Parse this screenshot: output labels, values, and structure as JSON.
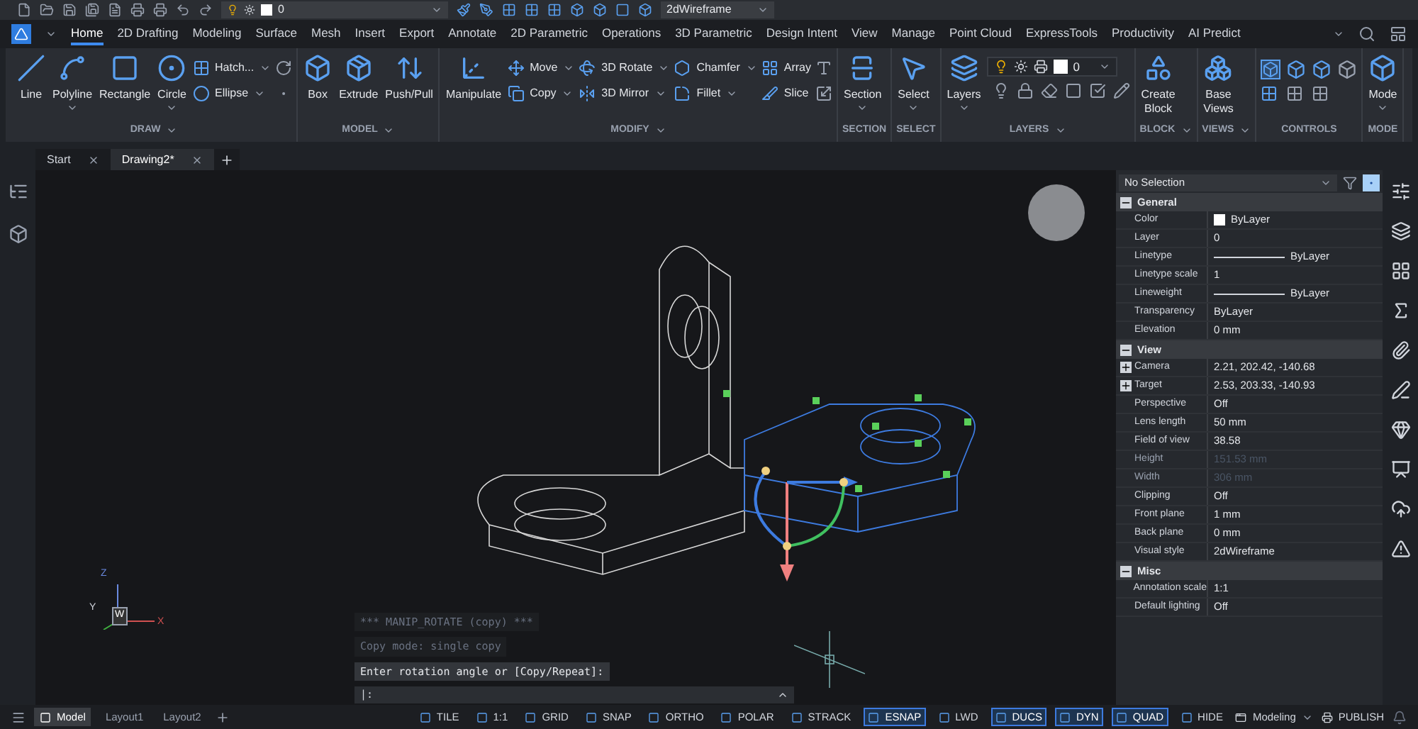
{
  "quick_access": {
    "layer": "0",
    "visual_style": "2dWireframe"
  },
  "ribbon_tabs": [
    {
      "label": "Home",
      "selected": true
    },
    {
      "label": "2D Drafting",
      "selected": false
    },
    {
      "label": "Modeling",
      "selected": false
    },
    {
      "label": "Surface",
      "selected": false
    },
    {
      "label": "Mesh",
      "selected": false
    },
    {
      "label": "Insert",
      "selected": false
    },
    {
      "label": "Export",
      "selected": false
    },
    {
      "label": "Annotate",
      "selected": false
    },
    {
      "label": "2D Parametric",
      "selected": false
    },
    {
      "label": "Operations",
      "selected": false
    },
    {
      "label": "3D Parametric",
      "selected": false
    },
    {
      "label": "Design Intent",
      "selected": false
    },
    {
      "label": "View",
      "selected": false
    },
    {
      "label": "Manage",
      "selected": false
    },
    {
      "label": "Point Cloud",
      "selected": false
    },
    {
      "label": "ExpressTools",
      "selected": false
    },
    {
      "label": "Productivity",
      "selected": false
    },
    {
      "label": "AI Predict",
      "selected": false
    }
  ],
  "ribbon_groups": [
    {
      "label": "DRAW",
      "menu": true,
      "large": [
        {
          "label": "Line",
          "dropdown": false
        },
        {
          "label": "Polyline",
          "dropdown": true
        },
        {
          "label": "Rectangle",
          "dropdown": false
        },
        {
          "label": "Circle",
          "dropdown": true
        }
      ],
      "small": [
        {
          "label": "Hatch...",
          "dropdown": true
        },
        {
          "label": "Ellipse",
          "dropdown": true
        }
      ]
    },
    {
      "label": "MODEL",
      "menu": true,
      "large": [
        {
          "label": "Box",
          "dropdown": false
        },
        {
          "label": "Extrude",
          "dropdown": false
        },
        {
          "label": "Push/Pull",
          "dropdown": false
        }
      ]
    },
    {
      "label": "MODIFY",
      "menu": true,
      "large": [
        {
          "label": "Manipulate",
          "dropdown": false
        }
      ],
      "small": [
        {
          "label": "Move",
          "dropdown": true
        },
        {
          "label": "Copy",
          "dropdown": true
        },
        {
          "label": "3D Rotate",
          "dropdown": true
        },
        {
          "label": "3D Mirror",
          "dropdown": true
        },
        {
          "label": "Chamfer",
          "dropdown": true
        },
        {
          "label": "Fillet",
          "dropdown": true
        },
        {
          "label": "Array",
          "dropdown": false
        },
        {
          "label": "Slice",
          "dropdown": false
        }
      ]
    },
    {
      "label": "SECTION",
      "menu": false,
      "large": [
        {
          "label": "Section",
          "dropdown": true
        }
      ]
    },
    {
      "label": "SELECT",
      "menu": false,
      "large": [
        {
          "label": "Select",
          "dropdown": true
        }
      ]
    },
    {
      "label": "LAYERS",
      "menu": true,
      "large": [
        {
          "label": "Layers",
          "dropdown": true
        }
      ],
      "layer_select": "0"
    },
    {
      "label": "BLOCK",
      "menu": true,
      "large": [
        {
          "label": "Create Block",
          "dropdown": false
        }
      ]
    },
    {
      "label": "VIEWS",
      "menu": true,
      "large": [
        {
          "label": "Base Views",
          "dropdown": false
        }
      ]
    },
    {
      "label": "CONTROLS",
      "menu": false
    },
    {
      "label": "MODE",
      "menu": false,
      "large": [
        {
          "label": "Mode",
          "dropdown": true
        }
      ]
    }
  ],
  "doc_tabs": [
    {
      "label": "Start",
      "selected": false
    },
    {
      "label": "Drawing2*",
      "selected": true
    }
  ],
  "viewport": {
    "ucs_labels": {
      "z": "Z",
      "y": "Y",
      "origin": "W",
      "x": "X"
    },
    "command_history": [
      {
        "text": "*** MANIP_ROTATE (copy) ***",
        "highlighted": false
      },
      {
        "text": "Copy mode: single copy",
        "highlighted": false
      },
      {
        "text": "Enter rotation angle or [Copy/Repeat]:",
        "highlighted": true
      }
    ],
    "command_prompt": "|:"
  },
  "properties": {
    "selection": "No Selection",
    "sections": [
      {
        "title": "General",
        "expanded": true,
        "rows": [
          {
            "label": "Color",
            "value": "ByLayer",
            "kind": "color",
            "expandable": false,
            "disabled": false
          },
          {
            "label": "Layer",
            "value": "0",
            "kind": "text",
            "expandable": false,
            "disabled": false
          },
          {
            "label": "Linetype",
            "value": "ByLayer",
            "kind": "line",
            "expandable": false,
            "disabled": false
          },
          {
            "label": "Linetype scale",
            "value": "1",
            "kind": "text",
            "expandable": false,
            "disabled": false
          },
          {
            "label": "Lineweight",
            "value": "ByLayer",
            "kind": "line",
            "expandable": false,
            "disabled": false
          },
          {
            "label": "Transparency",
            "value": "ByLayer",
            "kind": "text",
            "expandable": false,
            "disabled": false
          },
          {
            "label": "Elevation",
            "value": "0 mm",
            "kind": "text",
            "expandable": false,
            "disabled": false
          }
        ]
      },
      {
        "title": "View",
        "expanded": true,
        "rows": [
          {
            "label": "Camera",
            "value": "2.21, 202.42, -140.68",
            "kind": "text",
            "expandable": true,
            "disabled": false
          },
          {
            "label": "Target",
            "value": "2.53, 203.33, -140.93",
            "kind": "text",
            "expandable": true,
            "disabled": false
          },
          {
            "label": "Perspective",
            "value": "Off",
            "kind": "text",
            "expandable": false,
            "disabled": false
          },
          {
            "label": "Lens length",
            "value": "50 mm",
            "kind": "text",
            "expandable": false,
            "disabled": false
          },
          {
            "label": "Field of view",
            "value": "38.58",
            "kind": "text",
            "expandable": false,
            "disabled": false
          },
          {
            "label": "Height",
            "value": "151.53 mm",
            "kind": "text",
            "expandable": false,
            "disabled": true
          },
          {
            "label": "Width",
            "value": "306 mm",
            "kind": "text",
            "expandable": false,
            "disabled": true
          },
          {
            "label": "Clipping",
            "value": "Off",
            "kind": "text",
            "expandable": false,
            "disabled": false
          },
          {
            "label": "Front plane",
            "value": "1 mm",
            "kind": "text",
            "expandable": false,
            "disabled": false
          },
          {
            "label": "Back plane",
            "value": "0 mm",
            "kind": "text",
            "expandable": false,
            "disabled": false
          },
          {
            "label": "Visual style",
            "value": "2dWireframe",
            "kind": "text",
            "expandable": false,
            "disabled": false
          }
        ]
      },
      {
        "title": "Misc",
        "expanded": true,
        "rows": [
          {
            "label": "Annotation scale",
            "value": "1:1",
            "kind": "text",
            "expandable": false,
            "disabled": false
          },
          {
            "label": "Default lighting",
            "value": "Off",
            "kind": "text",
            "expandable": false,
            "disabled": false
          }
        ]
      }
    ]
  },
  "layout_tabs": [
    {
      "label": "Model",
      "selected": true
    },
    {
      "label": "Layout1",
      "selected": false
    },
    {
      "label": "Layout2",
      "selected": false
    }
  ],
  "status_toggles": [
    {
      "label": "TILE",
      "on": false
    },
    {
      "label": "1:1",
      "on": false
    },
    {
      "label": "GRID",
      "on": false
    },
    {
      "label": "SNAP",
      "on": false
    },
    {
      "label": "ORTHO",
      "on": false
    },
    {
      "label": "POLAR",
      "on": false
    },
    {
      "label": "STRACK",
      "on": false
    },
    {
      "label": "ESNAP",
      "on": true
    },
    {
      "label": "LWD",
      "on": false
    },
    {
      "label": "DUCS",
      "on": true
    },
    {
      "label": "DYN",
      "on": true
    },
    {
      "label": "QUAD",
      "on": true
    },
    {
      "label": "HIDE",
      "on": false
    }
  ],
  "workspace": "Modeling",
  "publish": "PUBLISH"
}
